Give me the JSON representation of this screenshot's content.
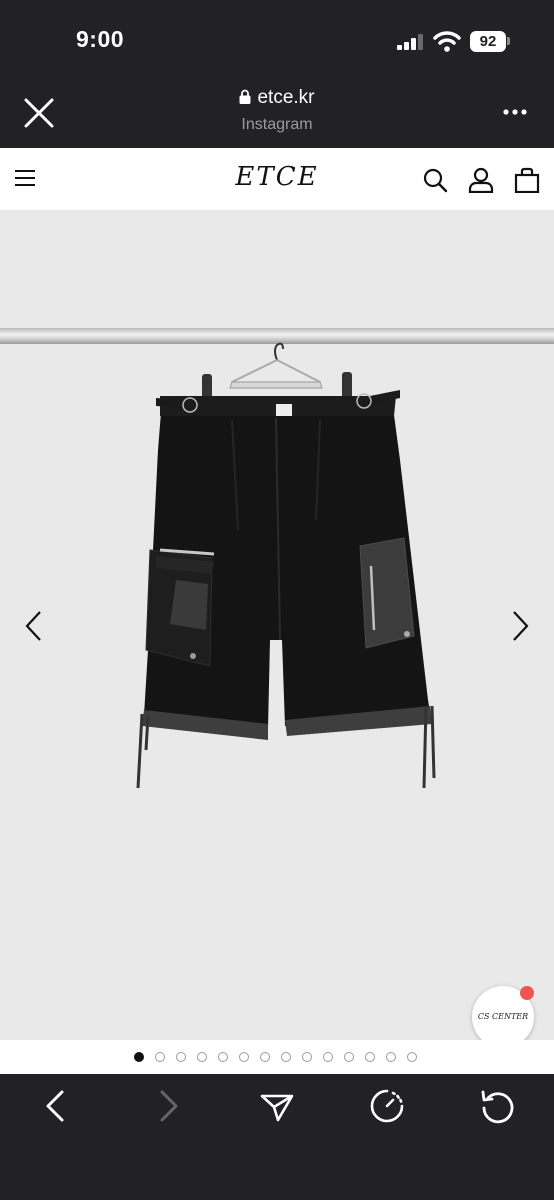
{
  "status_bar": {
    "time": "9:00",
    "battery": "92"
  },
  "browser": {
    "domain": "etce.kr",
    "subtitle": "Instagram"
  },
  "site": {
    "logo": "ETCE",
    "cs_label": "CS CENTER"
  },
  "gallery": {
    "total_slides": 14,
    "active_index": 0
  },
  "icons": {
    "close": "close-icon",
    "lock": "lock-icon",
    "more": "more-icon",
    "menu": "menu-icon",
    "search": "search-icon",
    "account": "account-icon",
    "bag": "bag-icon",
    "prev": "chevron-left-icon",
    "next": "chevron-right-icon",
    "back": "back-icon",
    "forward": "forward-icon",
    "share": "share-icon",
    "speed": "speed-icon",
    "reload": "reload-icon"
  },
  "colors": {
    "chrome": "#222226",
    "accent_dot": "#f05454",
    "product_bg": "#e9e9e9"
  }
}
